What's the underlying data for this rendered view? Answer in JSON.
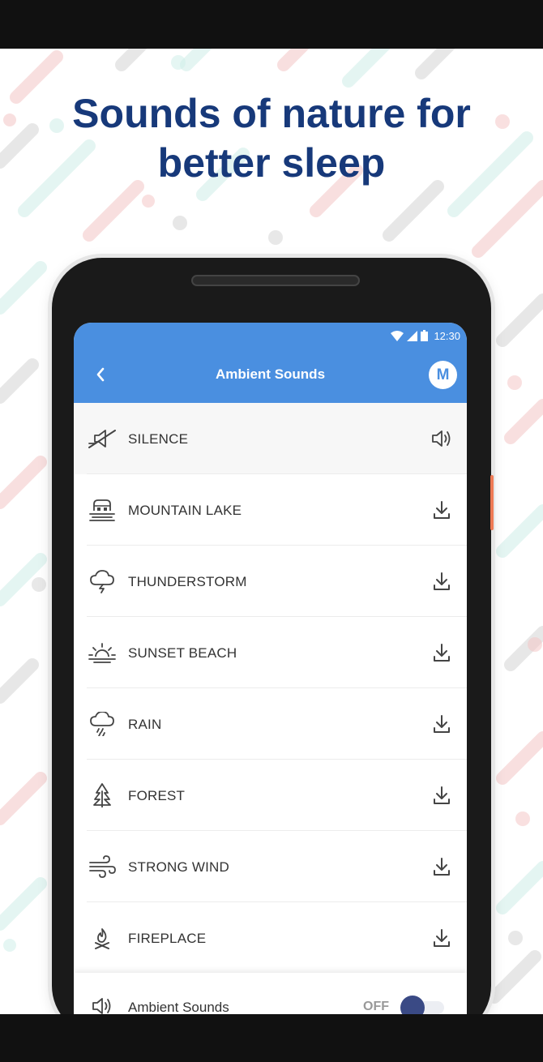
{
  "headline": {
    "line1": "Sounds of nature for",
    "line2": "better sleep"
  },
  "colors": {
    "headline": "#17397a",
    "appbar": "#4a8fe0",
    "toggle_knob": "#3a4a85",
    "accent_button": "#ee7a55"
  },
  "statusbar": {
    "time": "12:30",
    "icons": [
      "wifi-icon",
      "signal-icon",
      "battery-icon"
    ]
  },
  "appbar": {
    "title": "Ambient Sounds",
    "avatar_initial": "M",
    "back_icon": "chevron-left-icon"
  },
  "sounds": [
    {
      "label": "SILENCE",
      "icon": "mute-icon",
      "action": "speaker-icon",
      "active": true
    },
    {
      "label": "MOUNTAIN LAKE",
      "icon": "mountain-lake-icon",
      "action": "download-icon"
    },
    {
      "label": "THUNDERSTORM",
      "icon": "thunderstorm-icon",
      "action": "download-icon"
    },
    {
      "label": "SUNSET BEACH",
      "icon": "sunset-icon",
      "action": "download-icon"
    },
    {
      "label": "RAIN",
      "icon": "rain-icon",
      "action": "download-icon"
    },
    {
      "label": "FOREST",
      "icon": "tree-icon",
      "action": "download-icon"
    },
    {
      "label": "STRONG WIND",
      "icon": "wind-icon",
      "action": "download-icon"
    },
    {
      "label": "FIREPLACE",
      "icon": "fire-icon",
      "action": "download-icon"
    }
  ],
  "footer": {
    "label": "Ambient Sounds",
    "state": "OFF",
    "icon": "speaker-icon"
  }
}
